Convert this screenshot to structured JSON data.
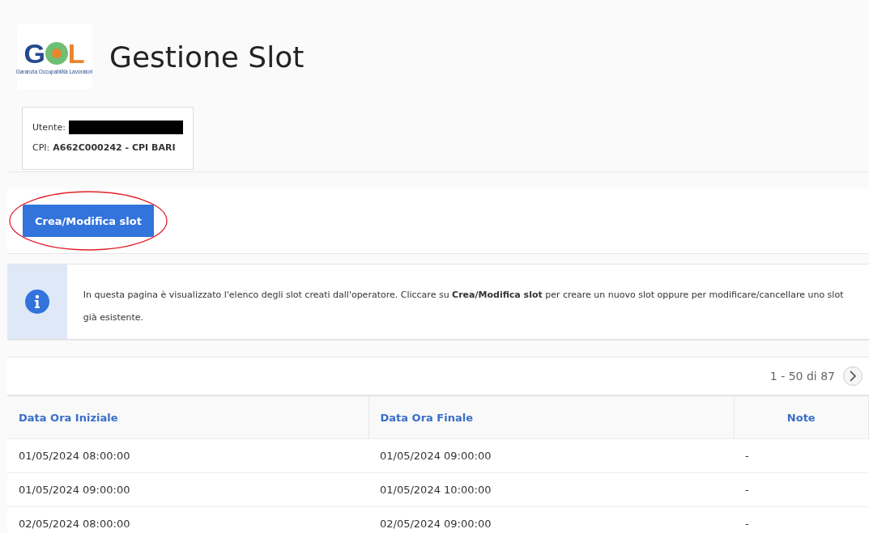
{
  "header": {
    "logo": {
      "first_letter": "G",
      "last_letter": "L",
      "tagline": "Garanzia Occupabilità Lavoratori"
    },
    "title": "Gestione Slot"
  },
  "user_card": {
    "user_label": "Utente:",
    "user_redacted": true,
    "cpi_label": "CPI:",
    "cpi_value": "A662C000242 - CPI BARI"
  },
  "action_button": {
    "label": "Crea/Modifica slot",
    "highlighted": true
  },
  "info": {
    "text": "In questa pagina è visualizzato l'elenco degli slot creati dall'operatore. Cliccare su **Crea/Modifica slot** per creare un nuovo slot oppure per modificare/cancellare uno slot già esistente."
  },
  "pagination": {
    "range": "1 - 50 di 87"
  },
  "table": {
    "columns": [
      {
        "label": "Data Ora Iniziale",
        "centered": false
      },
      {
        "label": "Data Ora Finale",
        "centered": false
      },
      {
        "label": "Note",
        "centered": true
      }
    ],
    "rows": [
      [
        "01/05/2024 08:00:00",
        "01/05/2024 09:00:00",
        "-"
      ],
      [
        "01/05/2024 09:00:00",
        "01/05/2024 10:00:00",
        "-"
      ],
      [
        "02/05/2024 08:00:00",
        "02/05/2024 09:00:00",
        "-"
      ]
    ]
  }
}
